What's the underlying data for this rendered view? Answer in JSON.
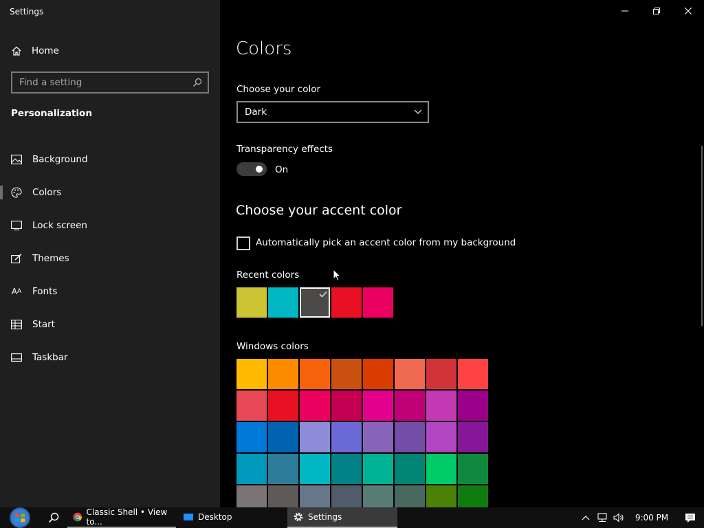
{
  "window": {
    "title": "Settings"
  },
  "sidebar": {
    "home_label": "Home",
    "search_placeholder": "Find a setting",
    "section": "Personalization",
    "items": [
      {
        "label": "Background",
        "icon": "picture-icon"
      },
      {
        "label": "Colors",
        "icon": "palette-icon",
        "active": true
      },
      {
        "label": "Lock screen",
        "icon": "lock-screen-icon"
      },
      {
        "label": "Themes",
        "icon": "brush-icon"
      },
      {
        "label": "Fonts",
        "icon": "font-icon"
      },
      {
        "label": "Start",
        "icon": "start-icon"
      },
      {
        "label": "Taskbar",
        "icon": "taskbar-icon"
      }
    ]
  },
  "main": {
    "title": "Colors",
    "choose_color_label": "Choose your color",
    "choose_color_value": "Dark",
    "transparency_label": "Transparency effects",
    "transparency_state": "On",
    "transparency_on": true,
    "accent_title": "Choose your accent color",
    "auto_accent_label": "Automatically pick an accent color from my background",
    "auto_accent_checked": false,
    "recent_label": "Recent colors",
    "recent_colors": [
      "#CCC432",
      "#00B7C3",
      "#4C4A48",
      "#E81123",
      "#EA005E"
    ],
    "recent_selected_index": 2,
    "windows_label": "Windows colors",
    "windows_colors": [
      "#FFB900",
      "#FF8C00",
      "#F7630C",
      "#CA5010",
      "#DA3B01",
      "#EF6950",
      "#D13438",
      "#FF4343",
      "#E74856",
      "#E81123",
      "#EA005E",
      "#C30052",
      "#E3008C",
      "#BF0077",
      "#C239B3",
      "#9A0089",
      "#0078D7",
      "#0063B1",
      "#8E8CD8",
      "#6B69D6",
      "#8764B8",
      "#744DA9",
      "#B146C2",
      "#881798",
      "#0099BC",
      "#2D7D9A",
      "#00B7C3",
      "#038387",
      "#00B294",
      "#018574",
      "#00CC6A",
      "#10893E",
      "#7A7574",
      "#5D5A58",
      "#68768A",
      "#515C6B",
      "#567C73",
      "#486860",
      "#498205",
      "#107C10"
    ]
  },
  "taskbar": {
    "apps": [
      {
        "label": "Classic Shell • View to...",
        "icon": "chrome-icon",
        "state": "running"
      },
      {
        "label": "Desktop",
        "icon": "desktop-icon",
        "state": "normal"
      },
      {
        "label": "Settings",
        "icon": "gear-icon",
        "state": "active"
      }
    ],
    "time": "9:00 PM"
  }
}
